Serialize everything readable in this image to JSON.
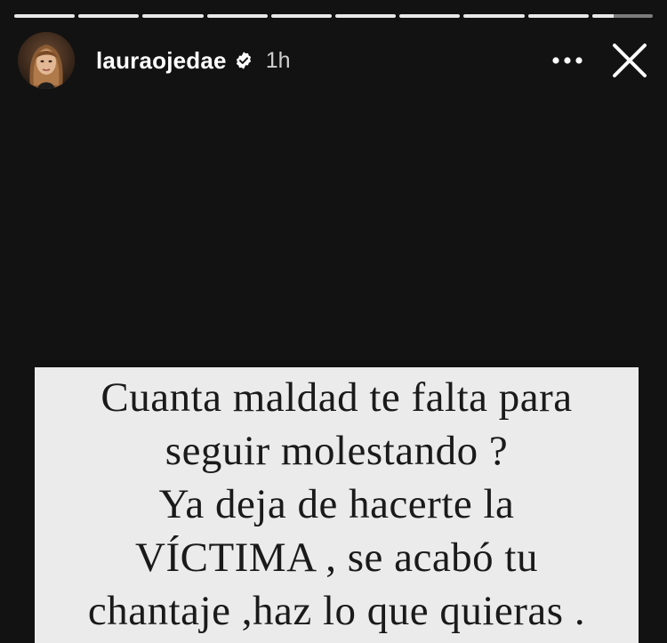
{
  "story": {
    "progress_segments": [
      1,
      1,
      1,
      1,
      1,
      1,
      1,
      1,
      1,
      0.35
    ],
    "header": {
      "username": "lauraojedae",
      "time": "1h",
      "verified_icon": "verified-badge-icon",
      "more_icon": "more-horizontal-icon",
      "close_icon": "close-icon"
    },
    "text_card": {
      "lines": [
        "Cuanta maldad te falta para",
        "seguir molestando ?",
        "Ya deja de hacerte la",
        "VÍCTIMA , se acabó tu",
        "chantaje ,haz lo que quieras ."
      ]
    }
  },
  "colors": {
    "background": "#121212",
    "card": "#ebebeb",
    "text_dark": "#1a1a1a",
    "progress_filled": "#e8e8e8"
  }
}
